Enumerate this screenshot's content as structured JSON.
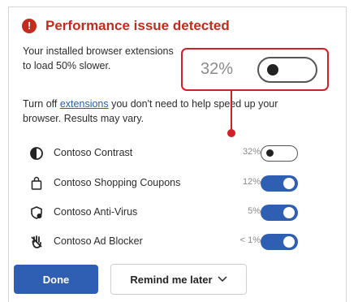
{
  "header": {
    "title": "Performance issue detected",
    "icon": "alert-icon",
    "color": "#c42b1c"
  },
  "message": {
    "line1": "Your installed browser extensions",
    "line1_end": "to load 50% slower.",
    "line2_prefix": "Turn off ",
    "line2_link": "extensions",
    "line2_suffix": " you don't need to help speed up your browser. Results may vary."
  },
  "extensions": [
    {
      "name": "Contoso Contrast",
      "impact": "32%",
      "enabled": false,
      "icon": "contrast-icon"
    },
    {
      "name": "Contoso Shopping Coupons",
      "impact": "12%",
      "enabled": true,
      "icon": "shopping-bag-icon"
    },
    {
      "name": "Contoso Anti-Virus",
      "impact": "5%",
      "enabled": true,
      "icon": "shield-icon"
    },
    {
      "name": "Contoso Ad Blocker",
      "impact": "< 1%",
      "enabled": true,
      "icon": "ad-blocker-icon"
    }
  ],
  "callout": {
    "impact": "32%",
    "enabled": false
  },
  "buttons": {
    "done": "Done",
    "remind": "Remind me later"
  },
  "colors": {
    "accent": "#2f5fb3",
    "callout": "#d11f26"
  }
}
